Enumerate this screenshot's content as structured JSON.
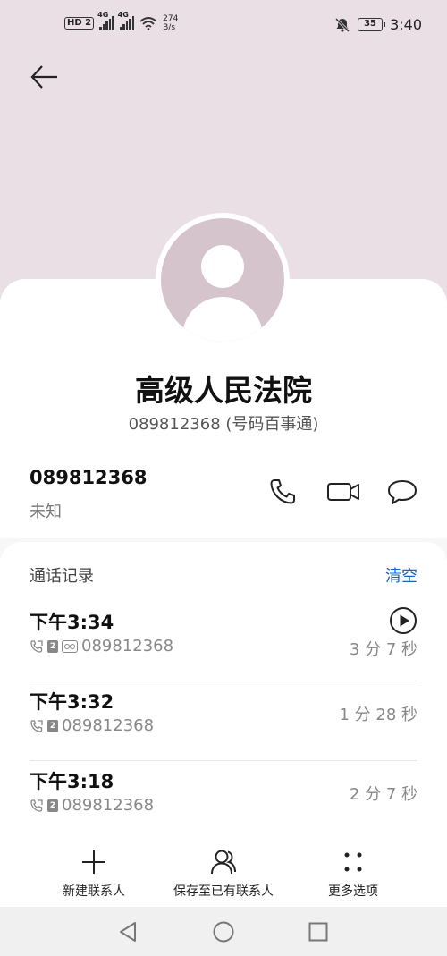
{
  "status_bar": {
    "hd_label": "HD",
    "sim_label": "2",
    "net1": "4G",
    "net2": "4G",
    "speed_value": "274",
    "speed_unit": "B/s",
    "battery": "35",
    "time": "3:40"
  },
  "contact": {
    "name": "高级人民法院",
    "subtitle": "089812368 (号码百事通)",
    "number": "089812368",
    "location": "未知"
  },
  "call_log": {
    "title": "通话记录",
    "clear_label": "清空",
    "entries": [
      {
        "time": "下午3:34",
        "sim": "2",
        "number": "089812368",
        "duration": "3 分 7 秒",
        "has_recording": true
      },
      {
        "time": "下午3:32",
        "sim": "2",
        "number": "089812368",
        "duration": "1 分 28 秒",
        "has_recording": false
      },
      {
        "time": "下午3:18",
        "sim": "2",
        "number": "089812368",
        "duration": "2 分 7 秒",
        "has_recording": false
      }
    ]
  },
  "actions": {
    "new_contact": "新建联系人",
    "save_existing": "保存至已有联系人",
    "more_options": "更多选项"
  },
  "icons": {
    "back": "back-arrow-icon",
    "call": "phone-icon",
    "video": "video-call-icon",
    "message": "message-icon",
    "play": "play-icon",
    "add": "plus-icon",
    "person": "person-icon",
    "more": "more-dots-icon"
  },
  "colors": {
    "header_bg": "#e9dfe4",
    "avatar_bg": "#d5c4cb",
    "accent": "#1565c0"
  }
}
